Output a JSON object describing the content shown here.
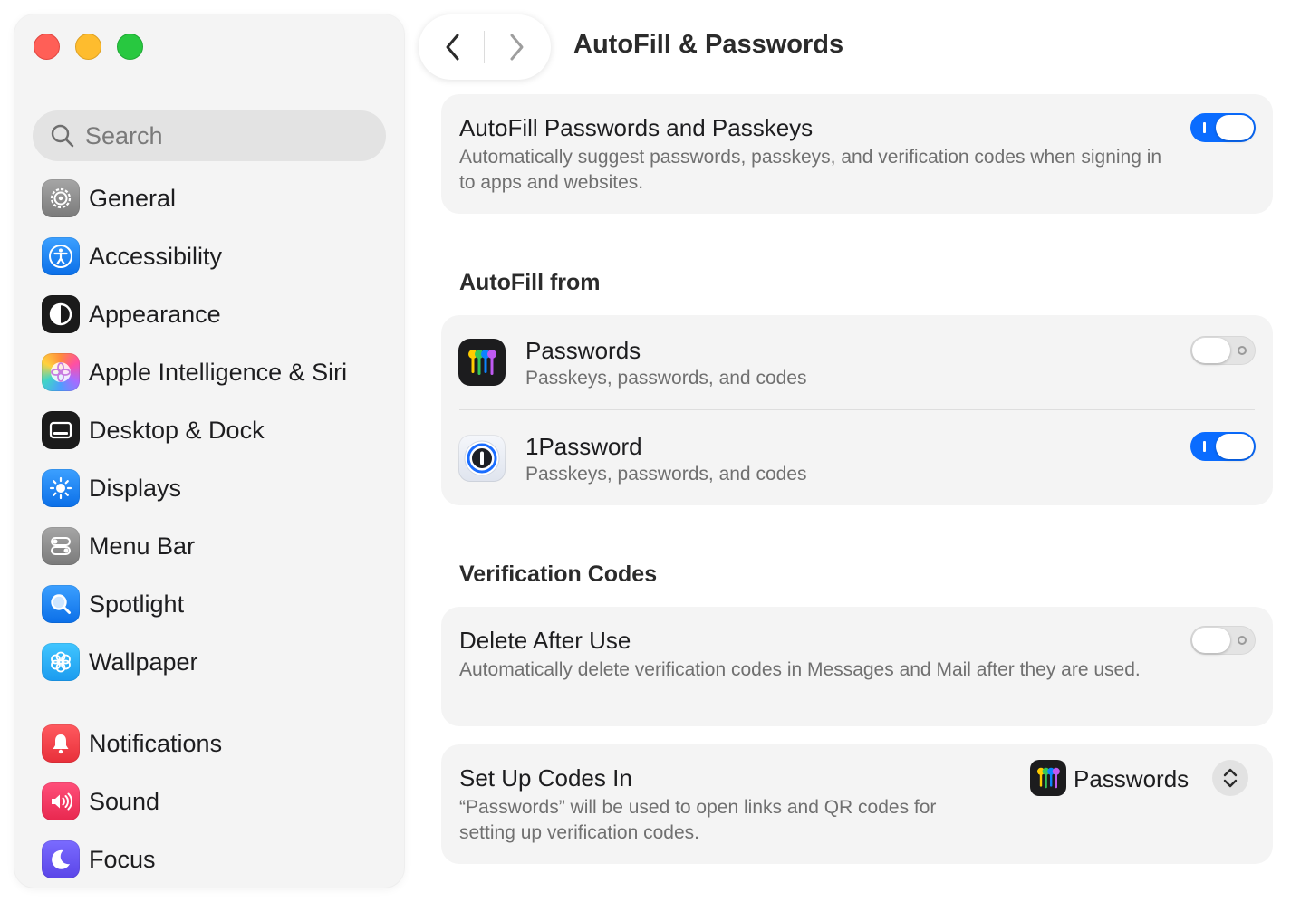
{
  "window": {
    "title": "AutoFill & Passwords"
  },
  "sidebar": {
    "search": {
      "placeholder": "Search"
    },
    "items": [
      {
        "label": "General",
        "icon": "gear-icon"
      },
      {
        "label": "Accessibility",
        "icon": "accessibility-icon"
      },
      {
        "label": "Appearance",
        "icon": "appearance-icon"
      },
      {
        "label": "Apple Intelligence & Siri",
        "icon": "apple-intelligence-icon"
      },
      {
        "label": "Desktop & Dock",
        "icon": "desktop-dock-icon"
      },
      {
        "label": "Displays",
        "icon": "displays-icon"
      },
      {
        "label": "Menu Bar",
        "icon": "menu-bar-icon"
      },
      {
        "label": "Spotlight",
        "icon": "spotlight-icon"
      },
      {
        "label": "Wallpaper",
        "icon": "wallpaper-icon"
      },
      {
        "label": "Notifications",
        "icon": "notifications-icon"
      },
      {
        "label": "Sound",
        "icon": "sound-icon"
      },
      {
        "label": "Focus",
        "icon": "focus-icon"
      }
    ]
  },
  "main": {
    "autofill_card": {
      "title": "AutoFill Passwords and Passkeys",
      "description": "Automatically suggest passwords, passkeys, and verification codes when signing in to apps and websites.",
      "enabled": true
    },
    "autofill_from": {
      "heading": "AutoFill from",
      "sources": [
        {
          "name": "Passwords",
          "description": "Passkeys, passwords, and codes",
          "enabled": false,
          "icon": "passwords-app-icon"
        },
        {
          "name": "1Password",
          "description": "Passkeys, passwords, and codes",
          "enabled": true,
          "icon": "onepassword-app-icon"
        }
      ]
    },
    "verification_codes": {
      "heading": "Verification Codes",
      "delete_after_use": {
        "title": "Delete After Use",
        "description": "Automatically delete verification codes in Messages and Mail after they are used.",
        "enabled": false
      },
      "setup_codes_in": {
        "title": "Set Up Codes In",
        "description": "“Passwords” will be used to open links and QR codes for setting up verification codes.",
        "selected_app": "Passwords"
      }
    }
  },
  "colors": {
    "accent": "#0a6cff",
    "close": "#ff5f57",
    "minimize": "#febc2e",
    "zoom": "#28c840"
  }
}
